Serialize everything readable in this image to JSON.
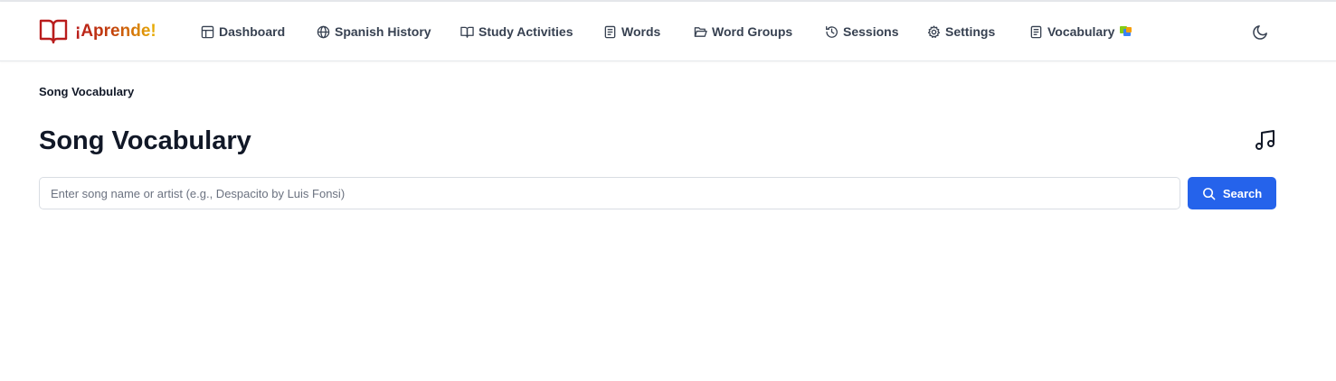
{
  "app": {
    "brand": "¡Aprende!",
    "brand_icon": "open-book-icon",
    "colors": {
      "brand_red": "#b91c1c",
      "brand_yellow": "#eab308",
      "accent": "#2563eb",
      "nav_text": "#374151",
      "border": "#e5e7eb"
    }
  },
  "nav": {
    "items": [
      {
        "label": "Dashboard",
        "icon": "layout-icon"
      },
      {
        "label": "Spanish History",
        "icon": "globe-icon"
      },
      {
        "label": "Study Activities",
        "icon": "book-open-icon"
      },
      {
        "label": "Words",
        "icon": "document-icon"
      },
      {
        "label": "Word Groups",
        "icon": "folder-open-icon"
      },
      {
        "label": "Sessions",
        "icon": "history-icon"
      },
      {
        "label": "Settings",
        "icon": "gear-icon"
      },
      {
        "label": "Vocabulary",
        "icon": "document-icon"
      }
    ],
    "theme_toggle_icon": "moon-icon"
  },
  "breadcrumb": "Song Vocabulary",
  "page": {
    "title": "Song Vocabulary",
    "title_icon": "music-note-icon"
  },
  "search": {
    "placeholder": "Enter song name or artist (e.g., Despacito by Luis Fonsi)",
    "value": "",
    "button_label": "Search",
    "button_icon": "search-icon"
  }
}
